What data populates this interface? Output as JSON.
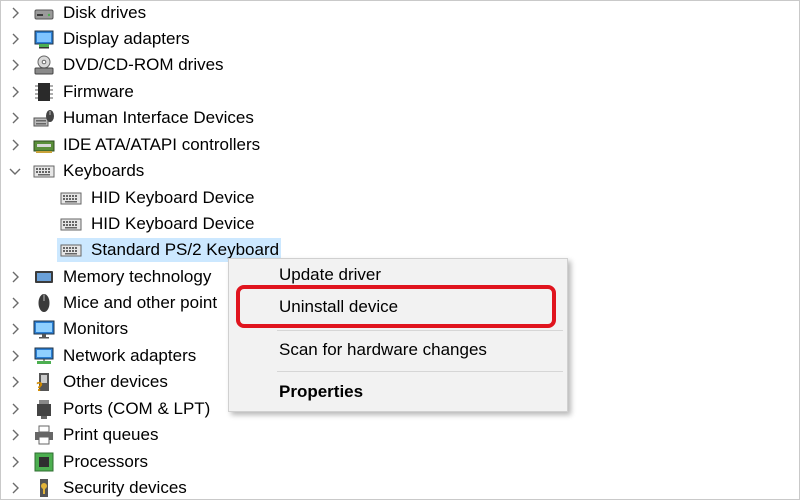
{
  "tree": {
    "items": [
      {
        "label": "Disk drives",
        "icon": "disk-drive-icon",
        "expanded": false
      },
      {
        "label": "Display adapters",
        "icon": "display-adapter-icon",
        "expanded": false
      },
      {
        "label": "DVD/CD-ROM drives",
        "icon": "dvd-drive-icon",
        "expanded": false
      },
      {
        "label": "Firmware",
        "icon": "firmware-chip-icon",
        "expanded": false
      },
      {
        "label": "Human Interface Devices",
        "icon": "hid-icon",
        "expanded": false
      },
      {
        "label": "IDE ATA/ATAPI controllers",
        "icon": "ide-controller-icon",
        "expanded": false
      },
      {
        "label": "Keyboards",
        "icon": "keyboard-icon",
        "expanded": true,
        "children": [
          {
            "label": "HID Keyboard Device",
            "icon": "keyboard-icon"
          },
          {
            "label": "HID Keyboard Device",
            "icon": "keyboard-icon"
          },
          {
            "label": "Standard PS/2 Keyboard",
            "icon": "keyboard-icon",
            "selected": true
          }
        ]
      },
      {
        "label": "Memory technology",
        "icon": "memory-icon",
        "expanded": false
      },
      {
        "label": "Mice and other point",
        "icon": "mouse-icon",
        "expanded": false
      },
      {
        "label": "Monitors",
        "icon": "monitor-icon",
        "expanded": false
      },
      {
        "label": "Network adapters",
        "icon": "network-adapter-icon",
        "expanded": false
      },
      {
        "label": "Other devices",
        "icon": "other-device-icon",
        "expanded": false
      },
      {
        "label": "Ports (COM & LPT)",
        "icon": "port-icon",
        "expanded": false
      },
      {
        "label": "Print queues",
        "icon": "printer-icon",
        "expanded": false
      },
      {
        "label": "Processors",
        "icon": "processor-icon",
        "expanded": false
      },
      {
        "label": "Security devices",
        "icon": "security-device-icon",
        "expanded": false
      }
    ]
  },
  "context_menu": {
    "update_driver": "Update driver",
    "uninstall_device": "Uninstall device",
    "scan_hardware": "Scan for hardware changes",
    "properties": "Properties"
  },
  "colors": {
    "selection": "#cce8ff",
    "highlight_ring": "#e0141e",
    "menu_bg": "#f2f2f2"
  }
}
